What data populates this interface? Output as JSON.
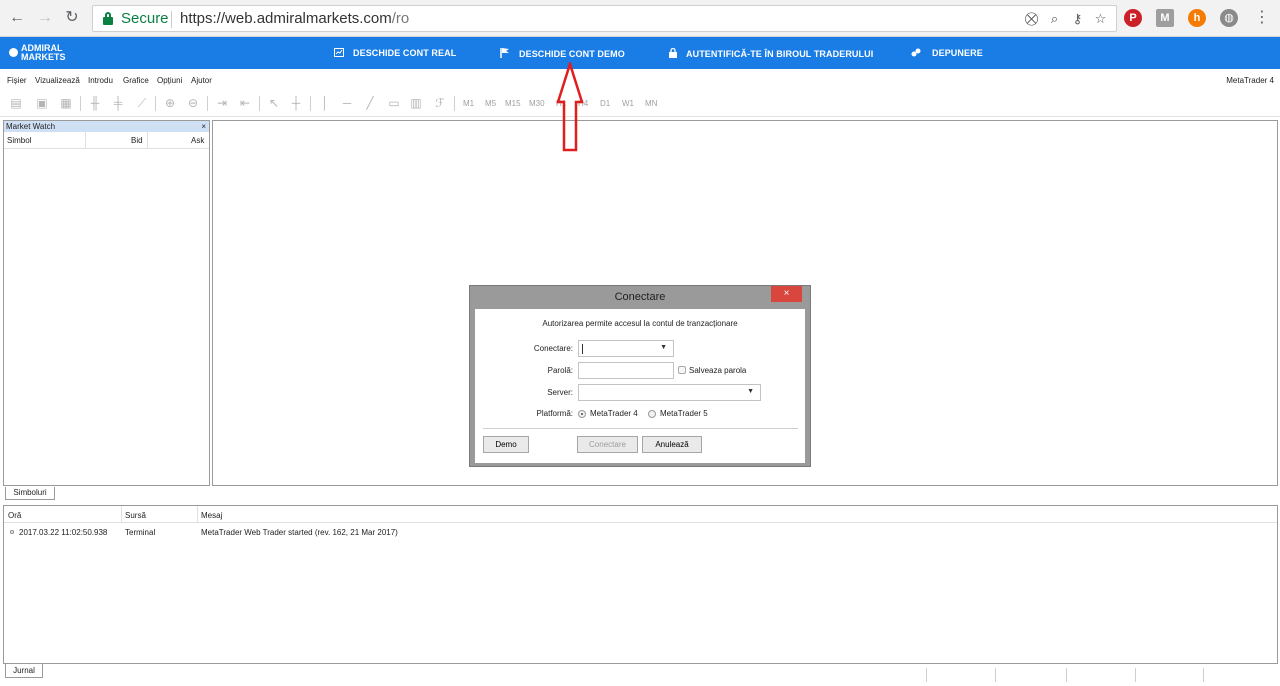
{
  "browser": {
    "secure_label": "Secure",
    "url_host": "https://web.admiralmarkets.com",
    "url_path": "/ro"
  },
  "brand": {
    "logo_line1": "ADMIRAL",
    "logo_line2": "MARKETS",
    "links": [
      {
        "label": "DESCHIDE CONT REAL",
        "icon": "chart-icon"
      },
      {
        "label": "DESCHIDE CONT DEMO",
        "icon": "flag-icon"
      },
      {
        "label": "AUTENTIFICĂ-TE ÎN BIROUL TRADERULUI",
        "icon": "lock-icon"
      },
      {
        "label": "DEPUNERE",
        "icon": "coins-icon"
      }
    ],
    "color": "#1a7de6"
  },
  "menu": {
    "items": [
      "Fișier",
      "Vizualizează",
      "Introdu",
      "Grafice",
      "Opțiuni",
      "Ajutor"
    ],
    "platform": "MetaTrader 4"
  },
  "toolbar": {
    "timeframes": [
      "M1",
      "M5",
      "M15",
      "M30",
      "H1",
      "H4",
      "D1",
      "W1",
      "MN"
    ]
  },
  "market_watch": {
    "title": "Market Watch",
    "close": "×",
    "columns": [
      "Simbol",
      "Bid",
      "Ask"
    ],
    "tab": "Simboluri"
  },
  "journal": {
    "columns": [
      "Oră",
      "Sursă",
      "Mesaj"
    ],
    "rows": [
      {
        "time": "2017.03.22 11:02:50.938",
        "source": "Terminal",
        "message": "MetaTrader Web Trader started (rev. 162, 21 Mar 2017)"
      }
    ],
    "tab": "Jurnal"
  },
  "dialog": {
    "title": "Conectare",
    "close": "×",
    "message": "Autorizarea permite accesul la contul de tranzacționare",
    "login_label": "Conectare:",
    "login_value": "",
    "password_label": "Parolă:",
    "save_password_label": "Salveaza parola",
    "server_label": "Server:",
    "platform_label": "Platformă:",
    "platform_options": [
      "MetaTrader 4",
      "MetaTrader 5"
    ],
    "selected_platform": "MetaTrader 4",
    "demo_button": "Demo",
    "connect_button": "Conectare",
    "cancel_button": "Anulează"
  }
}
